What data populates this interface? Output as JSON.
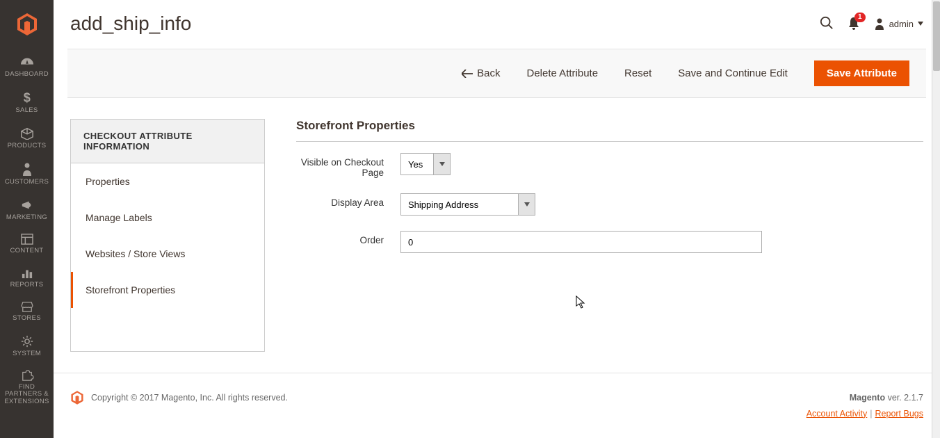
{
  "page_title": "add_ship_info",
  "admin_name": "admin",
  "notif_count": "1",
  "nav": [
    {
      "label": "DASHBOARD"
    },
    {
      "label": "SALES"
    },
    {
      "label": "PRODUCTS"
    },
    {
      "label": "CUSTOMERS"
    },
    {
      "label": "MARKETING"
    },
    {
      "label": "CONTENT"
    },
    {
      "label": "REPORTS"
    },
    {
      "label": "STORES"
    },
    {
      "label": "SYSTEM"
    },
    {
      "label": "FIND PARTNERS & EXTENSIONS"
    }
  ],
  "toolbar": {
    "back": "Back",
    "delete": "Delete Attribute",
    "reset": "Reset",
    "save_continue": "Save and Continue Edit",
    "save": "Save Attribute"
  },
  "sidepanel": {
    "head": "CHECKOUT ATTRIBUTE INFORMATION",
    "items": [
      "Properties",
      "Manage Labels",
      "Websites / Store Views",
      "Storefront Properties"
    ]
  },
  "form": {
    "section_title": "Storefront Properties",
    "visible_label": "Visible on Checkout Page",
    "visible_value": "Yes",
    "display_label": "Display Area",
    "display_value": "Shipping Address",
    "order_label": "Order",
    "order_value": "0"
  },
  "footer": {
    "copyright": "Copyright © 2017 Magento, Inc. All rights reserved.",
    "brand": "Magento",
    "version": " ver. 2.1.7",
    "account_activity": "Account Activity",
    "report_bugs": "Report Bugs"
  }
}
